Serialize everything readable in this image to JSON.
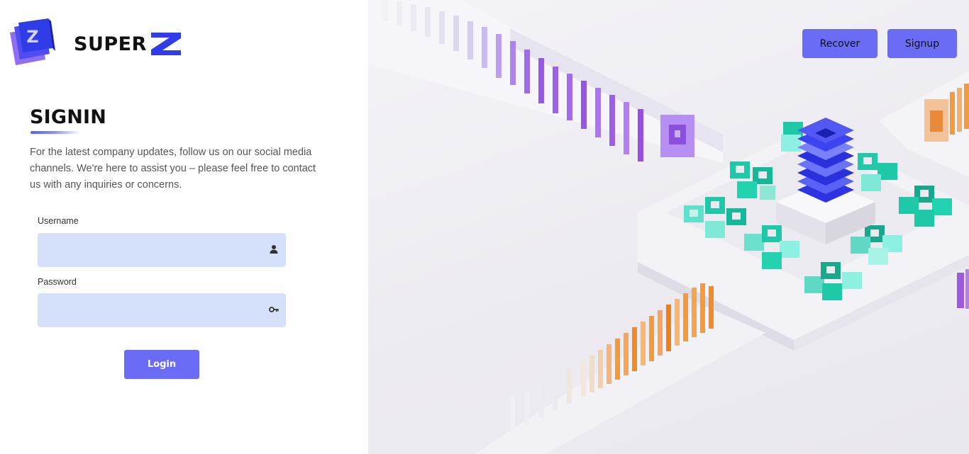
{
  "brand": {
    "name": "SUPER",
    "accent": "#3b40e8"
  },
  "auth": {
    "title": "SIGNIN",
    "intro": "For the latest company updates, follow us on our social media channels. We're here to assist you – please feel free to contact us with any inquiries or concerns.",
    "username_label": "Username",
    "username_value": "",
    "username_icon": "user-icon",
    "password_label": "Password",
    "password_value": "",
    "password_icon": "key-icon",
    "login_label": "Login"
  },
  "nav": {
    "recover_label": "Recover",
    "signup_label": "Signup"
  },
  "colors": {
    "primary_button": "#6a6cf6",
    "input_bg": "#d5e1fb",
    "teal": "#1fc9a8",
    "orange": "#f59a3c",
    "purple": "#9b5ae0",
    "blue": "#3b44f0"
  }
}
